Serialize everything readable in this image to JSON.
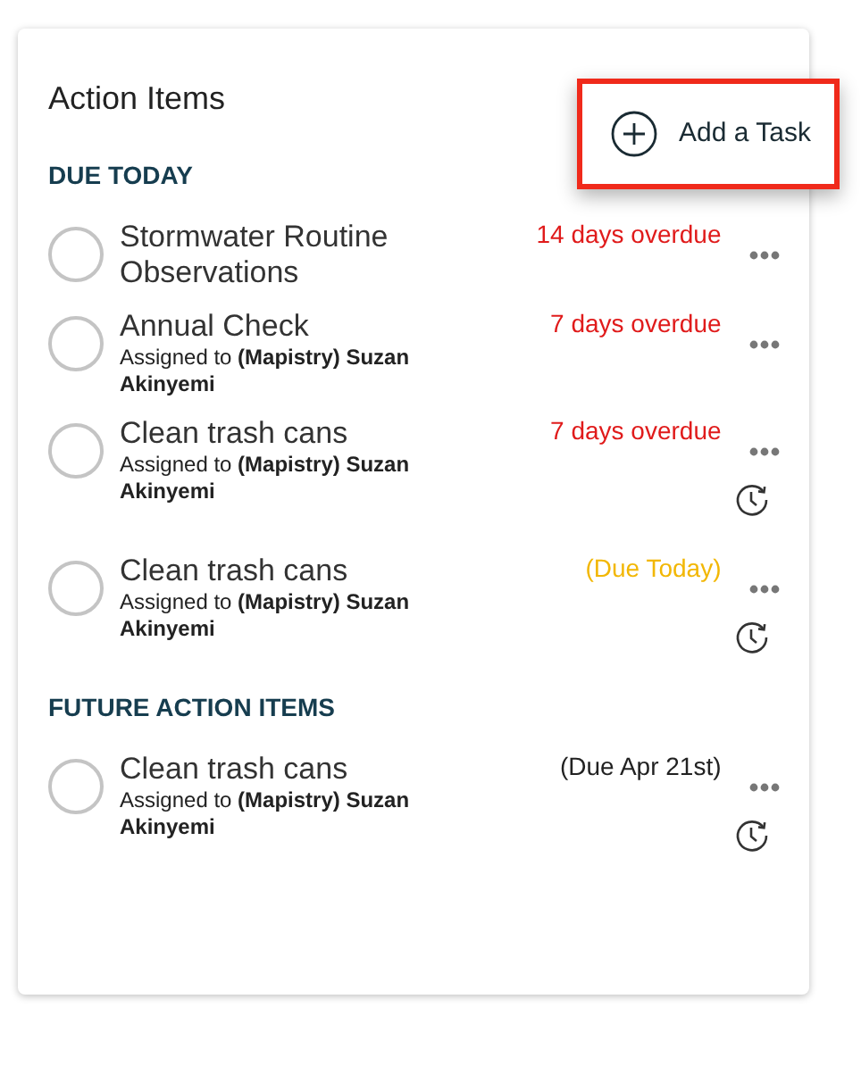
{
  "panel": {
    "title": "Action Items"
  },
  "add_button": {
    "label": "Add a Task",
    "highlighted": true
  },
  "sections": [
    {
      "heading": "DUE TODAY",
      "items": [
        {
          "title": "Stormwater Routine Observations",
          "checked": false,
          "status": "14 days overdue",
          "color": "#e01b1b",
          "recurring": false
        },
        {
          "title": "Annual Check",
          "subtitle": "Assigned to **(Mapistry) Suzan Akinyemi**",
          "checked": false,
          "status": "7 days overdue",
          "color": "#e01b1b",
          "recurring": false
        },
        {
          "title": "Clean trash cans",
          "subtitle": "Assigned to **(Mapistry) Suzan Akinyemi**",
          "checked": false,
          "status": "7 days overdue",
          "color": "#e01b1b",
          "recurring": true
        },
        {
          "title": "Clean trash cans",
          "subtitle": "Assigned to **(Mapistry) Suzan Akinyemi**",
          "checked": false,
          "status": "(Due Today)",
          "color": "#f2b705",
          "recurring": true
        }
      ]
    },
    {
      "heading": "FUTURE ACTION ITEMS",
      "items": [
        {
          "title": "Clean trash cans",
          "subtitle": "Assigned to **(Mapistry) Suzan Akinyemi**",
          "checked": false,
          "status": "(Due Apr 21st)",
          "color": "#222222",
          "recurring": true
        }
      ]
    }
  ]
}
